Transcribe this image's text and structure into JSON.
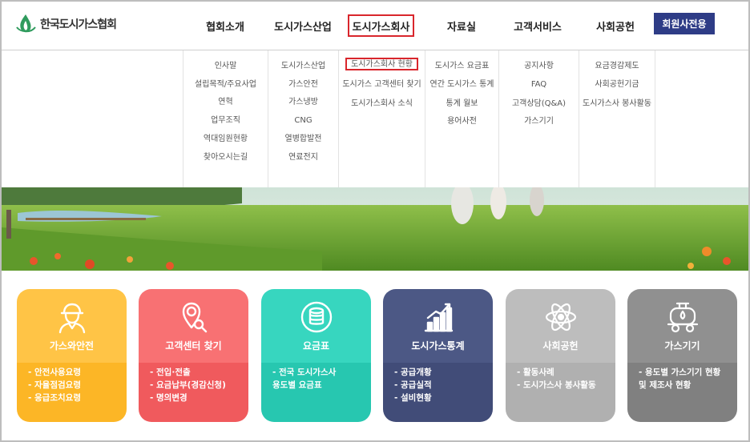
{
  "header": {
    "logo_text": "한국도시가스협회",
    "nav": [
      "협회소개",
      "도시가스산업",
      "도시가스회사",
      "자료실",
      "고객서비스",
      "사회공헌"
    ],
    "member_button": "회원사전용"
  },
  "dropdown": {
    "columns": [
      [
        "인사말",
        "설립목적/주요사업",
        "연혁",
        "업무조직",
        "역대임원현황",
        "찾아오시는길"
      ],
      [
        "도시가스산업",
        "가스안전",
        "가스냉방",
        "CNG",
        "열병합발전",
        "연료전지"
      ],
      [
        "도시가스회사 현황",
        "도시가스 고객센터 찾기",
        "도시가스회사 소식"
      ],
      [
        "도시가스 요금표",
        "연간 도시가스 통계",
        "통계 월보",
        "용어사전"
      ],
      [
        "공지사항",
        "FAQ",
        "고객상담(Q&A)",
        "가스기기"
      ],
      [
        "요금경감제도",
        "사회공헌기금",
        "도시가스사 봉사활동"
      ]
    ]
  },
  "cards": [
    {
      "title": "가스와안전",
      "items": [
        "- 안전사용요령",
        "- 자율점검요령",
        "- 응급조치요령"
      ],
      "icon": "worker-icon",
      "color": "#ffc446",
      "bottom": "#fcb626"
    },
    {
      "title": "고객센터 찾기",
      "items": [
        "- 전입·전출",
        "- 요금납부(경감신청)",
        "- 명의변경"
      ],
      "icon": "location-search-icon",
      "color": "#f87173",
      "bottom": "#f05a5d"
    },
    {
      "title": "요금표",
      "items": [
        "- 전국 도시가스사",
        "  용도별 요금표"
      ],
      "icon": "coins-icon",
      "color": "#37d6bf",
      "bottom": "#27c7b0"
    },
    {
      "title": "도시가스통계",
      "items": [
        "- 공급개황",
        "- 공급실적",
        "- 설비현황"
      ],
      "icon": "bar-chart-icon",
      "color": "#4c5885",
      "bottom": "#414c78"
    },
    {
      "title": "사회공헌",
      "items": [
        "- 활동사례",
        "- 도시가스사 봉사활동"
      ],
      "icon": "atom-icon",
      "color": "#bdbdbd",
      "bottom": "#b0b0b0"
    },
    {
      "title": "가스기기",
      "items": [
        "- 용도별 가스기기 현황",
        "  및 제조사 현황"
      ],
      "icon": "gas-tank-icon",
      "color": "#909090",
      "bottom": "#808080"
    }
  ]
}
